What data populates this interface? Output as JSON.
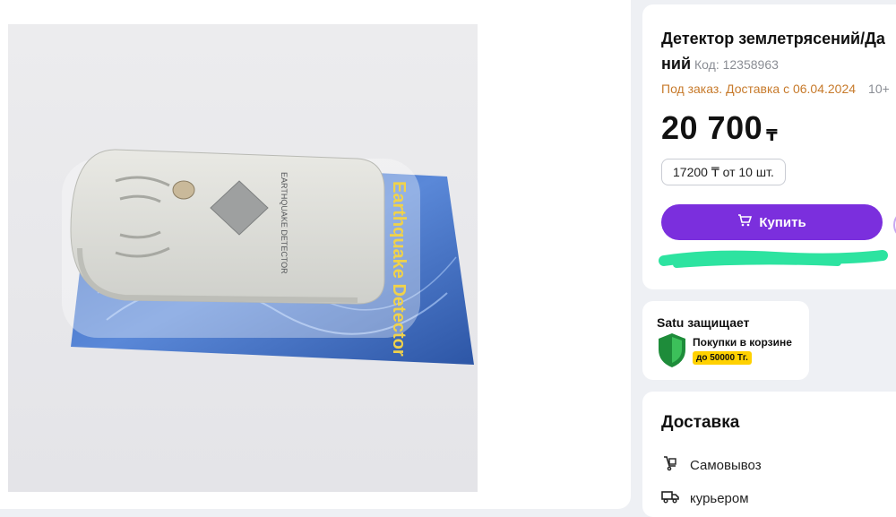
{
  "product": {
    "title_line1": "Детектор землетрясений/Да",
    "title_line2": "ний",
    "code": "Код: 12358963",
    "order_note": "Под заказ. Доставка с 06.04.2024",
    "order_extra": "10+",
    "price": "20 700",
    "currency": "₸",
    "bulk_price": "17200 ₸ от 10 шт.",
    "buy_label": "Купить",
    "image_texts": {
      "device_label": "EARTHQUAKE DETECTOR",
      "card_label": "Earthquake Detector"
    }
  },
  "protection": {
    "title": "Satu защищает",
    "text": "Покупки в корзине",
    "badge": "до 50000 Тг."
  },
  "delivery": {
    "title": "Доставка",
    "options": [
      {
        "label": "Самовывоз",
        "icon": "pickup-icon"
      },
      {
        "label": "курьером",
        "icon": "truck-icon"
      }
    ]
  },
  "colors": {
    "accent": "#7b2fdd",
    "order_note": "#c77a2b",
    "badge": "#ffd100",
    "scribble": "#2de3a0"
  }
}
